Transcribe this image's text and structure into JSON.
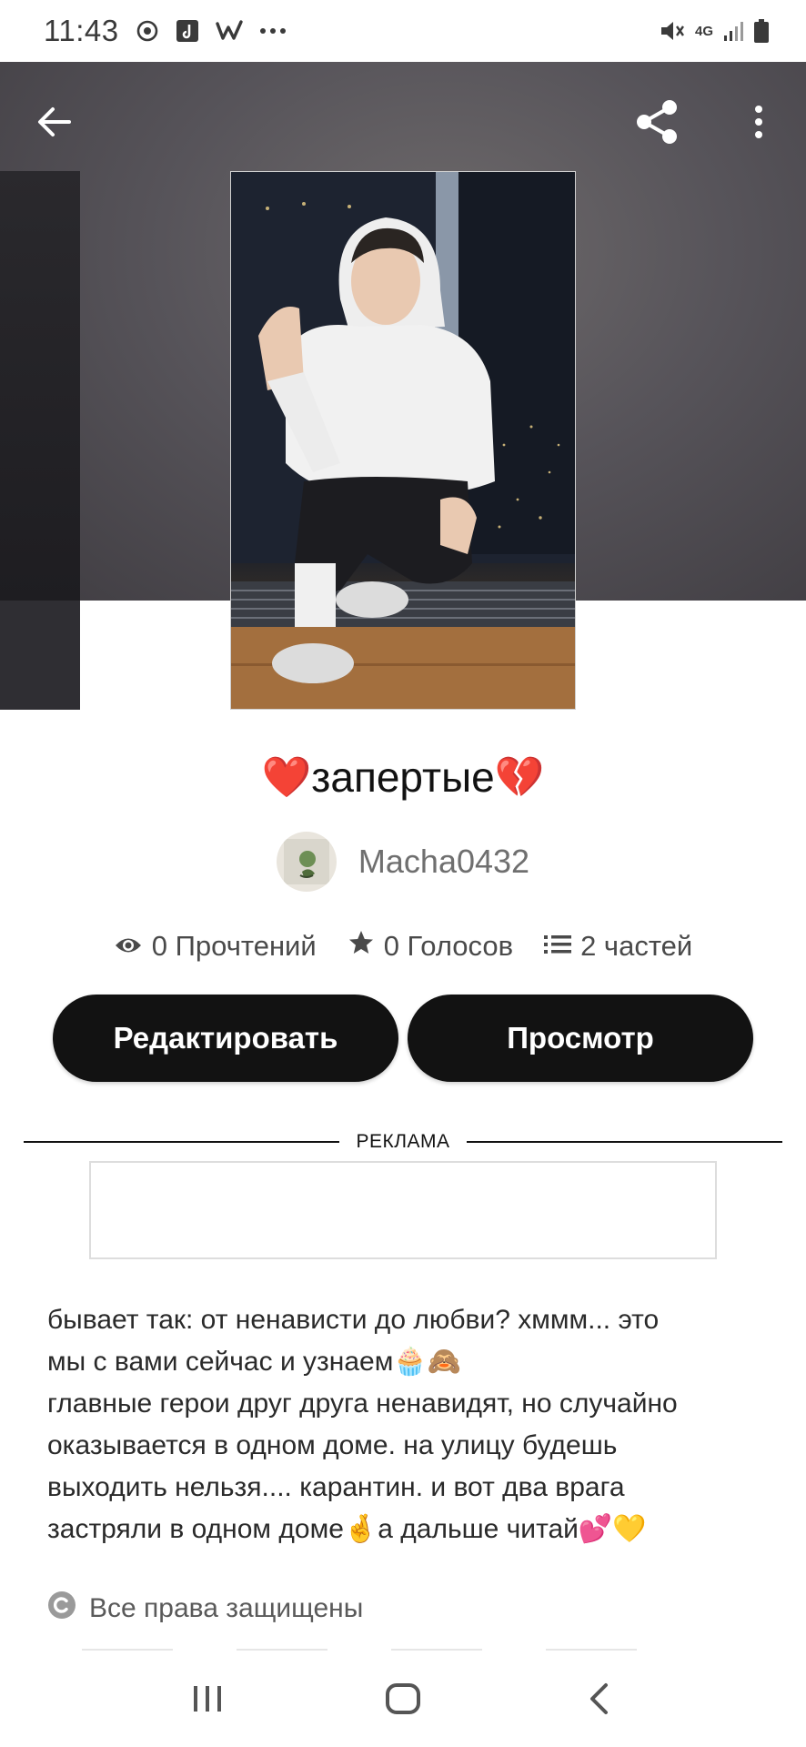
{
  "status_bar": {
    "time": "11:43",
    "network": "4G",
    "icons": [
      "sync-icon",
      "music-note-icon",
      "wattpad-w-icon",
      "more-dots-icon",
      "mute-icon",
      "signal-icon",
      "battery-icon"
    ]
  },
  "header": {
    "back_icon": "arrow-left-icon",
    "share_icon": "share-icon",
    "menu_icon": "more-vertical-icon"
  },
  "story": {
    "title_prefix_emoji": "❤️",
    "title": "запертые",
    "title_suffix_emoji": "💔",
    "author": "Macha0432",
    "stats": {
      "reads": "0 Прочтений",
      "votes": "0 Голосов",
      "parts": "2 частей"
    }
  },
  "actions": {
    "edit_label": "Редактировать",
    "view_label": "Просмотр"
  },
  "ad": {
    "label": "РЕКЛАМА"
  },
  "description": {
    "line1": "бывает так: от ненависти до любви?  хммм... это",
    "line2_text": "мы с вами сейчас и узнаем",
    "line2_emoji": "🧁🙈",
    "line3": "главные герои друг друга ненавидят, но случайно",
    "line4": "оказывается в одном доме. на улицу будешь",
    "line5": "выходить нельзя.... карантин. и вот два врага",
    "line6_text_a": "застряли в одном доме",
    "line6_emoji_a": "🤞",
    "line6_text_b": "а дальше читай",
    "line6_emoji_b": "💕💛"
  },
  "copyright": {
    "text": "Все права защищены"
  },
  "colors": {
    "button_bg": "#121212",
    "button_text": "#ffffff",
    "author_text": "#6f6f6f"
  }
}
